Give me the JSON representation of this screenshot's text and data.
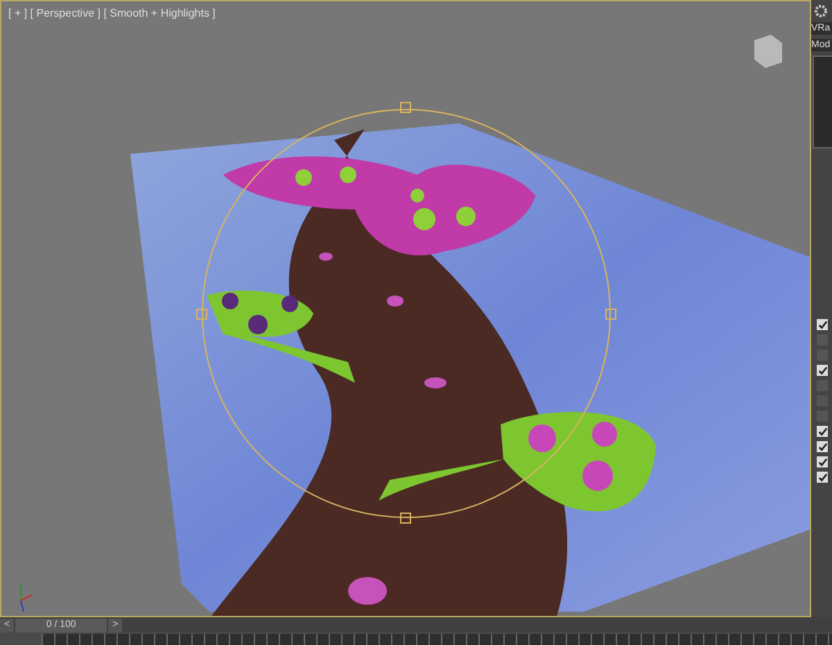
{
  "viewport": {
    "label": "[ + ] [ Perspective ] [ Smooth + Highlights ]"
  },
  "command_panel": {
    "fields": [
      "VRa",
      "Mod"
    ],
    "checkboxes": [
      {
        "checked": true
      },
      {
        "checked": false
      },
      {
        "checked": false
      },
      {
        "checked": true
      },
      {
        "checked": false
      },
      {
        "checked": false
      },
      {
        "checked": false
      },
      {
        "checked": true
      },
      {
        "checked": true
      },
      {
        "checked": true
      },
      {
        "checked": true
      }
    ]
  },
  "timeline": {
    "prev": "<",
    "frame": "0 / 100",
    "next": ">",
    "level": 0
  }
}
